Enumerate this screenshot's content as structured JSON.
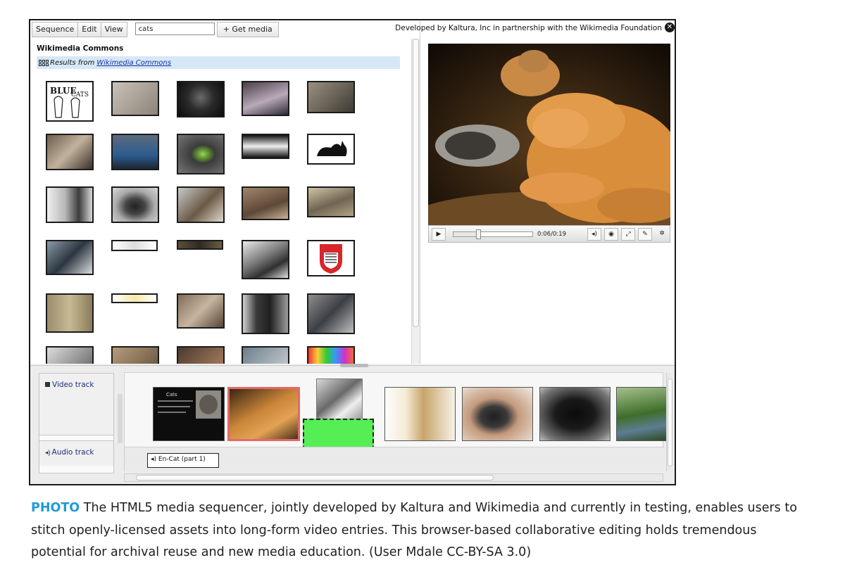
{
  "menubar": {
    "items": [
      "Sequence",
      "Edit",
      "View"
    ],
    "search_value": "cats",
    "get_media_label": "+ Get media"
  },
  "browser": {
    "provider_title": "Wikimedia Commons",
    "results_prefix": "Results from",
    "results_link": "Wikimedia Commons"
  },
  "player": {
    "credit": "Developed by Kaltura, Inc in partnership with the Wikimedia Foundation",
    "close_glyph": "✕",
    "play_glyph": "▶",
    "time": "0:06/0:19",
    "progress": 0.32,
    "icons": [
      "volume-icon",
      "captions-icon",
      "fullscreen-icon",
      "tools-icon",
      "settings-icon"
    ]
  },
  "timeline": {
    "video_track_label": "Video track",
    "audio_track_label": "Audio track",
    "audio_clip_label": "En-Cat (part 1)"
  },
  "caption": {
    "label": "PHOTO",
    "text": "The HTML5 media sequencer, jointly developed by Kaltura and Wikimedia and currently in testing, enables users to stitch openly-licensed assets into long-form video entries. This browser-based collaborative editing holds tremendous potential for archival reuse and new media education. (User Mdale CC-BY-SA 3.0)"
  },
  "colors": {
    "caption_label": "#1f9ad6",
    "selected_clip_border": "#e16a6a",
    "drop_target": "#55ee55",
    "results_bar": "#d6e8f7"
  }
}
